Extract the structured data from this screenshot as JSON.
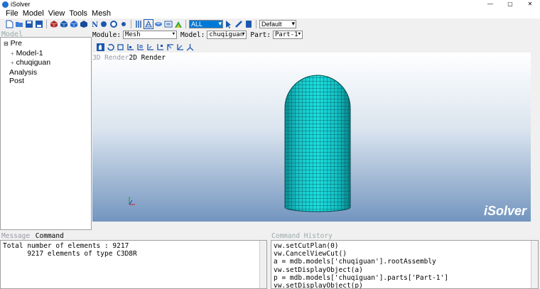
{
  "window": {
    "title": "iSolver",
    "min": "—",
    "max": "▢",
    "close": "✕"
  },
  "menu": [
    "File",
    "Model",
    "View",
    "Tools",
    "Mesh"
  ],
  "toolbar": {
    "filter_value": "ALL",
    "style_value": "Default"
  },
  "left": {
    "header": "Model",
    "tree": [
      {
        "label": "Pre",
        "marker": "⊟",
        "indent": 0
      },
      {
        "label": "Model-1",
        "marker": "+",
        "indent": 1
      },
      {
        "label": "chuqiguan",
        "marker": "+",
        "indent": 1
      },
      {
        "label": "Analysis",
        "marker": "",
        "indent": 0
      },
      {
        "label": "Post",
        "marker": "",
        "indent": 0
      }
    ]
  },
  "modbar": {
    "module_label": "Module:",
    "module_value": "Mesh",
    "model_label": "Model:",
    "model_value": "chuqiguan",
    "part_label": "Part:",
    "part_value": "Part-1"
  },
  "render_tabs": {
    "tab3d": "3D Render",
    "tab2d": "2D Render"
  },
  "viewport": {
    "watermark": "iSolver"
  },
  "bottom": {
    "tab_message": "Message",
    "tab_command": "Command",
    "messages": [
      "Total number of elements : 9217",
      "      9217 elements of type C3D8R"
    ],
    "history_title": "Command History",
    "history": [
      "vw.setCutPlan(0)",
      "vw.CancelViewCut()",
      "a = mdb.models['chuqiguan'].rootAssembly",
      "vw.setDisplayObject(a)",
      "p = mdb.models['chuqiguan'].parts['Part-1']",
      "vw.setDisplayObject(p)"
    ]
  }
}
